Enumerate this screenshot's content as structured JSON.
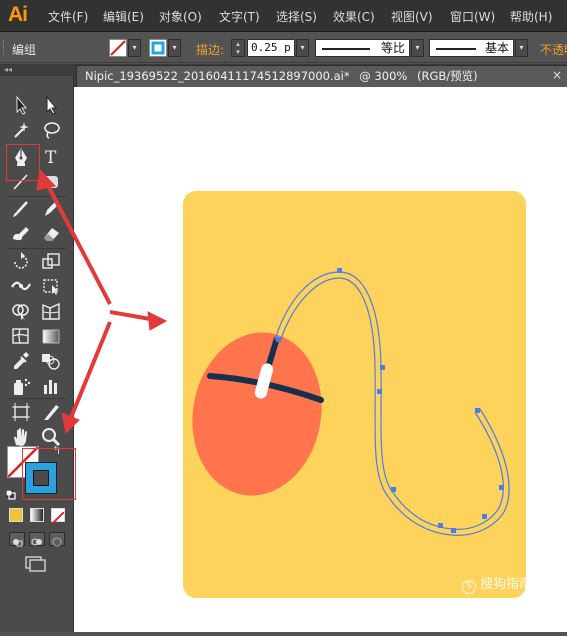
{
  "app": {
    "logo": "Ai"
  },
  "menu": [
    {
      "label": "文件(F)"
    },
    {
      "label": "编辑(E)"
    },
    {
      "label": "对象(O)"
    },
    {
      "label": "文字(T)"
    },
    {
      "label": "选择(S)"
    },
    {
      "label": "效果(C)"
    },
    {
      "label": "视图(V)"
    },
    {
      "label": "窗口(W)"
    },
    {
      "label": "帮助(H)"
    }
  ],
  "control_bar": {
    "selection_label": "编组",
    "stroke_label": "描边:",
    "stroke_weight": "0.25 p",
    "variable_width": "等比",
    "brush_definition": "基本",
    "opacity_label": "不透明"
  },
  "document": {
    "tab_title": "Nipic_19369522_20160411174512897000.ai*",
    "zoom": "@ 300%",
    "color_mode": "(RGB/预览)",
    "close_glyph": "×"
  },
  "tools": [
    "selection-tool",
    "direct-selection-tool",
    "magic-wand-tool",
    "lasso-tool",
    "pen-tool",
    "type-tool",
    "line-segment-tool",
    "rectangle-tool",
    "paintbrush-tool",
    "pencil-tool",
    "blob-brush-tool",
    "eraser-tool",
    "rotate-tool",
    "scale-tool",
    "width-tool",
    "free-transform-tool",
    "shape-builder-tool",
    "perspective-grid-tool",
    "mesh-tool",
    "gradient-tool",
    "eyedropper-tool",
    "blend-tool",
    "symbol-sprayer-tool",
    "column-graph-tool",
    "artboard-tool",
    "slice-tool",
    "hand-tool",
    "zoom-tool"
  ],
  "colors": {
    "artboard_bg": "#FDD35C",
    "mouse_body": "#FF734D",
    "mouse_line": "#17304F",
    "mouse_wheel": "#FFFFFF",
    "cable_path": "#4F7BE8",
    "fill_swatch": "#29A3E0",
    "annotation": "#E23A3A"
  },
  "watermark": "搜狗指南"
}
